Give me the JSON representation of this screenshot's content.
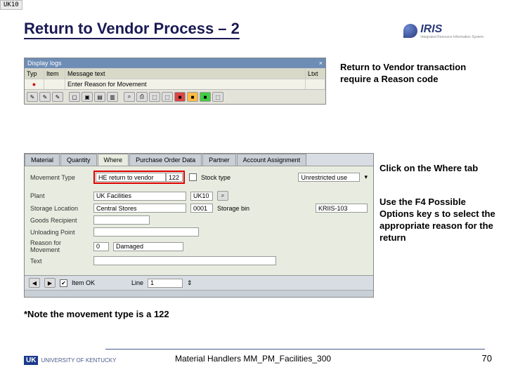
{
  "top_chip": "UK10",
  "title": "Return to Vendor Process – 2",
  "logo": {
    "text": "IRIS",
    "sub": "Integrated Resource\nInformation System"
  },
  "sap1": {
    "window_title": "Display logs",
    "headers": {
      "typ": "Typ",
      "item": "Item",
      "msg": "Message text",
      "ltxt": "Ltxt"
    },
    "row": {
      "typ_icon": "●",
      "item": "",
      "msg": "Enter Reason for Movement",
      "ltxt": ""
    },
    "toolbar_icons": [
      "✎",
      "✎",
      "✎",
      "",
      "",
      "",
      "▢",
      "▣",
      "▤",
      "▥",
      "⌕",
      "⎙",
      "⬚",
      "⬚",
      "⬚",
      "⬚",
      "⬚"
    ]
  },
  "anno1": "Return to Vendor transaction require a Reason code",
  "anno2": "Click on the Where tab",
  "anno3": "Use the F4 Possible Options key s to select the appropriate reason for the return",
  "sap2": {
    "tabs": [
      "Material",
      "Quantity",
      "Where",
      "Purchase Order Data",
      "Partner",
      "Account Assignment"
    ],
    "active_tab": "Where",
    "rows": {
      "movement_type": {
        "label": "Movement Type",
        "val1": "HE return to vendor",
        "val2": "122",
        "stock_label": "Stock type",
        "stock_val": "Unrestricted use",
        "dd": "▾"
      },
      "plant": {
        "label": "Plant",
        "val1": "UK Facilities",
        "val2": "UK10",
        "btn": "⌕"
      },
      "sloc": {
        "label": "Storage Location",
        "val1": "Central Stores",
        "val2": "0001",
        "bin_label": "Storage bin",
        "bin_val": "KRIIS-103"
      },
      "goods": {
        "label": "Goods Recipient",
        "val": ""
      },
      "unload": {
        "label": "Unloading Point",
        "val": ""
      },
      "reason": {
        "label": "Reason for Movement",
        "code": "0",
        "text": "Damaged"
      },
      "text": {
        "label": "Text",
        "val": ""
      }
    },
    "footer": {
      "nav_icons": [
        "◀",
        "▶"
      ],
      "chk": "✔",
      "chk_label": "Item OK",
      "line_label": "Line",
      "line_val": "1",
      "spin": "⇕"
    }
  },
  "note": "*Note the movement type is a 122",
  "footer": {
    "uk": "UK",
    "uni": "UNIVERSITY OF KENTUCKY",
    "course": "Material Handlers MM_PM_Facilities_300",
    "page": "70"
  }
}
